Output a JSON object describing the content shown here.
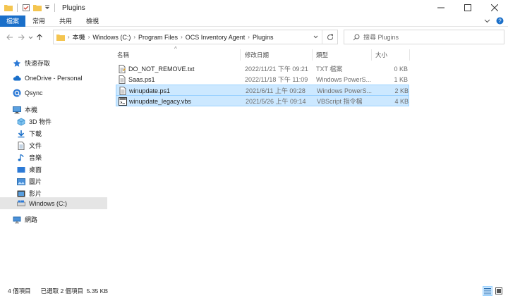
{
  "window": {
    "title": "Plugins"
  },
  "ribbon": {
    "tabs": [
      {
        "label": "檔案",
        "active": true
      },
      {
        "label": "常用"
      },
      {
        "label": "共用"
      },
      {
        "label": "檢視"
      }
    ]
  },
  "address": {
    "crumbs": [
      "本機",
      "Windows (C:)",
      "Program Files",
      "OCS Inventory Agent",
      "Plugins"
    ]
  },
  "search": {
    "placeholder": "搜尋 Plugins"
  },
  "sidebar": {
    "items": [
      {
        "label": "快速存取",
        "icon": "star-icon"
      },
      {
        "label": "OneDrive - Personal",
        "icon": "cloud-icon"
      },
      {
        "label": "Qsync",
        "icon": "qsync-icon"
      },
      {
        "label": "本機",
        "icon": "computer-icon"
      },
      {
        "label": "3D 物件",
        "icon": "cube-icon"
      },
      {
        "label": "下載",
        "icon": "download-icon"
      },
      {
        "label": "文件",
        "icon": "document-icon"
      },
      {
        "label": "音樂",
        "icon": "music-icon"
      },
      {
        "label": "桌面",
        "icon": "desktop-icon"
      },
      {
        "label": "圖片",
        "icon": "pictures-icon"
      },
      {
        "label": "影片",
        "icon": "video-icon"
      },
      {
        "label": "Windows (C:)",
        "icon": "drive-icon",
        "selected": true
      },
      {
        "label": "網路",
        "icon": "network-icon"
      }
    ]
  },
  "columns": {
    "name": "名稱",
    "date": "修改日期",
    "type": "類型",
    "size": "大小"
  },
  "files": [
    {
      "name": "DO_NOT_REMOVE.txt",
      "date": "2022/11/21 下午 09:21",
      "type": "TXT 檔案",
      "size": "0 KB",
      "icon": "text-file-icon",
      "selected": false
    },
    {
      "name": "Saas.ps1",
      "date": "2022/11/18 下午 11:09",
      "type": "Windows PowerS...",
      "size": "1 KB",
      "icon": "script-file-icon",
      "selected": false
    },
    {
      "name": "winupdate.ps1",
      "date": "2021/6/11 上午 09:28",
      "type": "Windows PowerS...",
      "size": "2 KB",
      "icon": "script-file-icon",
      "selected": true
    },
    {
      "name": "winupdate_legacy.vbs",
      "date": "2021/5/26 上午 09:14",
      "type": "VBScript 指令檔",
      "size": "4 KB",
      "icon": "vbs-file-icon",
      "selected": true
    }
  ],
  "status": {
    "item_count": "4 個項目",
    "selection": "已選取 2 個項目  5.35 KB"
  },
  "colors": {
    "accent": "#1a6fc9",
    "selection_bg": "#cce8ff",
    "selection_border": "#99d1ff",
    "folder": "#f4c550"
  }
}
